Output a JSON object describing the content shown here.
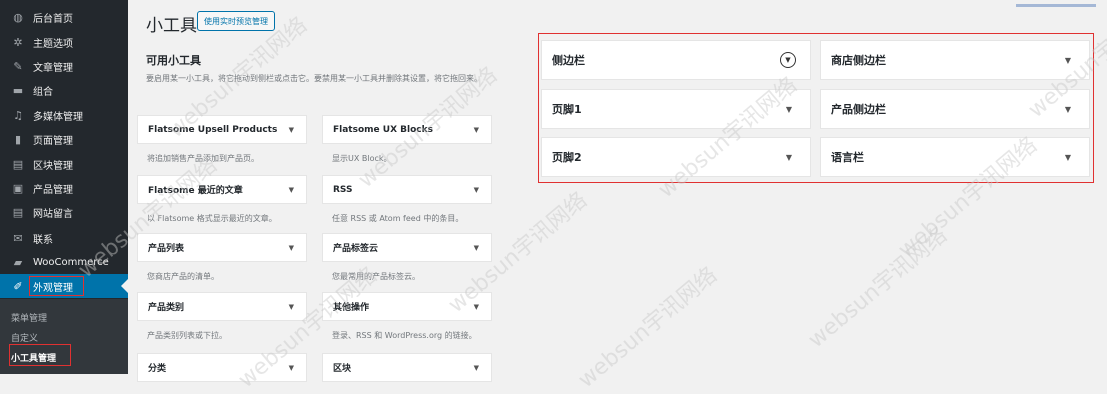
{
  "sidebar": {
    "items": [
      {
        "label": "后台首页",
        "icon": "dashboard-icon",
        "glyph": "◍"
      },
      {
        "label": "主题选项",
        "icon": "gear-icon",
        "glyph": "✲"
      },
      {
        "label": "文章管理",
        "icon": "pin-icon",
        "glyph": "✎"
      },
      {
        "label": "组合",
        "icon": "folder-icon",
        "glyph": "▬"
      },
      {
        "label": "多媒体管理",
        "icon": "media-icon",
        "glyph": "♫"
      },
      {
        "label": "页面管理",
        "icon": "page-icon",
        "glyph": "▮"
      },
      {
        "label": "区块管理",
        "icon": "blocks-icon",
        "glyph": "▤"
      },
      {
        "label": "产品管理",
        "icon": "products-icon",
        "glyph": "▣"
      },
      {
        "label": "网站留言",
        "icon": "comments-icon",
        "glyph": "▤"
      },
      {
        "label": "联系",
        "icon": "mail-icon",
        "glyph": "✉"
      },
      {
        "label": "WooCommerce",
        "icon": "woocommerce-icon",
        "glyph": "▰"
      },
      {
        "label": "外观管理",
        "icon": "appearance-icon",
        "glyph": "✐"
      }
    ],
    "submenu": [
      {
        "label": "菜单管理"
      },
      {
        "label": "自定义"
      },
      {
        "label": "小工具管理"
      }
    ]
  },
  "header": {
    "title": "小工具",
    "preview_button": "使用实时预览管理"
  },
  "available": {
    "title": "可用小工具",
    "description": "要启用某一小工具，将它拖动到侧栏或点击它。要禁用某一小工具并删除其设置，将它拖回来。"
  },
  "widgets": [
    {
      "name": "Flatsome Upsell Products",
      "desc": "将追加销售产品添加到产品页。"
    },
    {
      "name": "Flatsome UX Blocks",
      "desc": "显示UX Block。"
    },
    {
      "name": "Flatsome 最近的文章",
      "desc": "以 Flatsome 格式显示最近的文章。"
    },
    {
      "name": "RSS",
      "desc": "任意 RSS 或 Atom feed 中的条目。"
    },
    {
      "name": "产品列表",
      "desc": "您商店产品的清单。"
    },
    {
      "name": "产品标签云",
      "desc": "您最常用的产品标签云。"
    },
    {
      "name": "产品类别",
      "desc": "产品类别列表或下拉。"
    },
    {
      "name": "其他操作",
      "desc": "登录、RSS 和 WordPress.org 的链接。"
    },
    {
      "name": "分类",
      "desc": ""
    },
    {
      "name": "区块",
      "desc": ""
    }
  ],
  "widget_areas": [
    {
      "name": "侧边栏",
      "circle": true
    },
    {
      "name": "商店侧边栏",
      "circle": false
    },
    {
      "name": "页脚1",
      "circle": false
    },
    {
      "name": "产品侧边栏",
      "circle": false
    },
    {
      "name": "页脚2",
      "circle": false
    },
    {
      "name": "语言栏",
      "circle": false
    }
  ],
  "watermark": "websun宇讯网络",
  "colors": {
    "sidebar_bg": "#23282d",
    "active_bg": "#0073aa",
    "highlight_box": "#e03131"
  }
}
